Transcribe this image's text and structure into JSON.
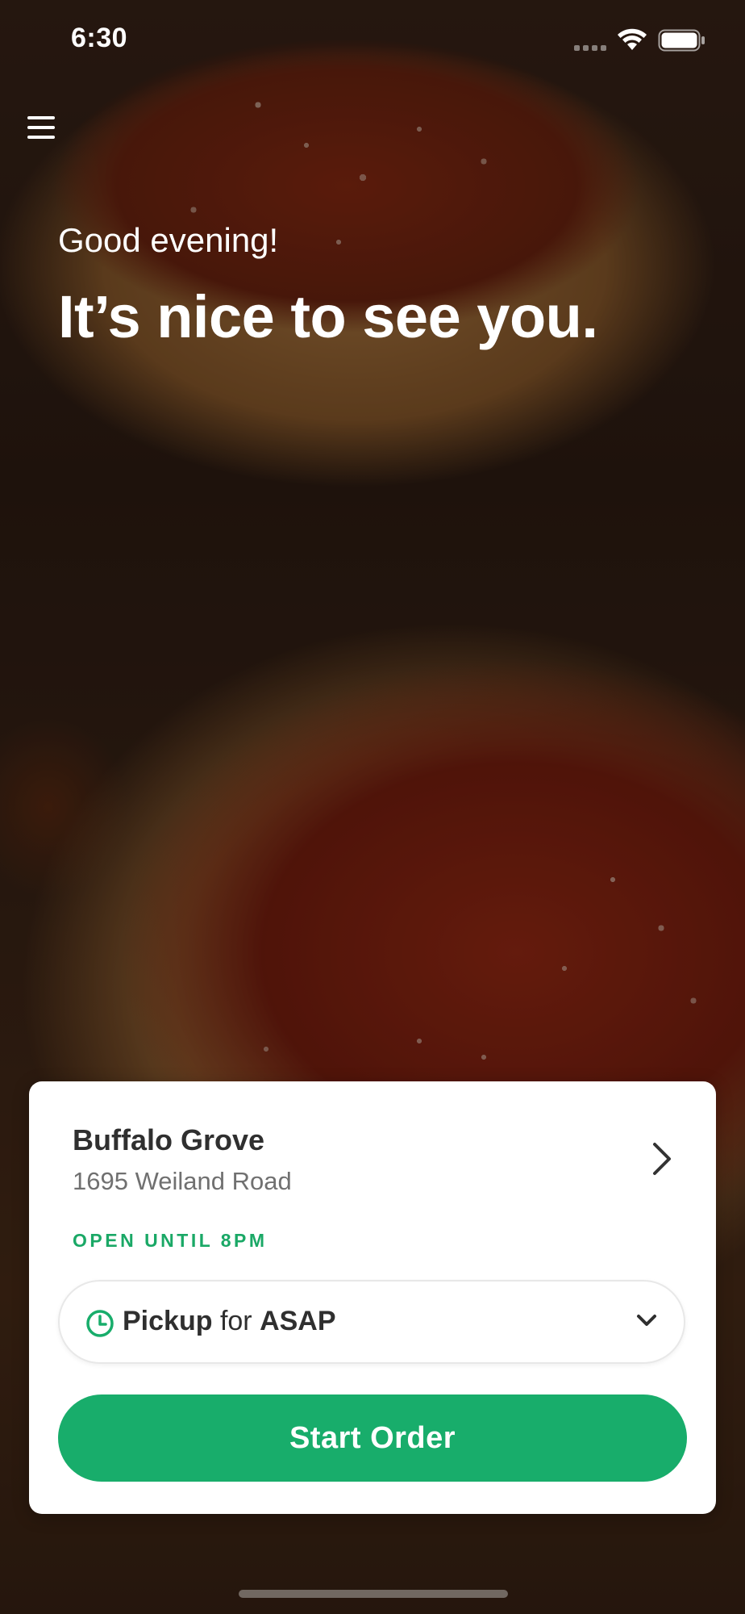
{
  "status_bar": {
    "time": "6:30"
  },
  "hero": {
    "greeting": "Good evening!",
    "headline": "It’s nice to see you."
  },
  "location_card": {
    "name": "Buffalo Grove",
    "address": "1695 Weiland Road",
    "open_status": "OPEN UNTIL 8PM",
    "pickup": {
      "method": "Pickup",
      "connector": "for",
      "time": "ASAP"
    },
    "start_order_label": "Start Order"
  },
  "colors": {
    "accent_green": "#18ad6b",
    "open_text_green": "#1aa866",
    "card_background": "#ffffff"
  },
  "icons": {
    "menu": "hamburger-menu-icon",
    "location_nav": "chevron-right-icon",
    "time": "clock-icon",
    "dropdown": "chevron-down-icon",
    "wifi": "wifi-icon",
    "battery": "battery-icon"
  }
}
